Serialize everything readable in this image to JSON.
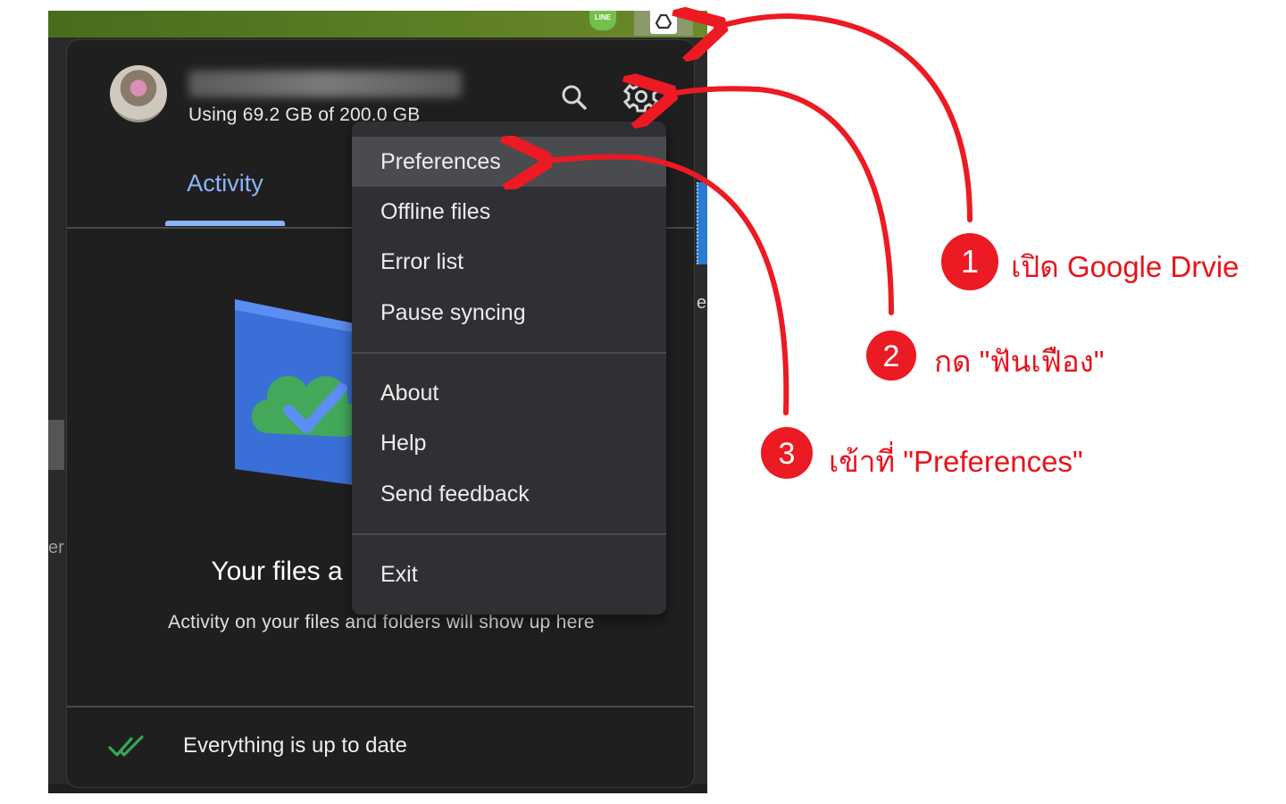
{
  "tray": {
    "line_icon_text": "LINE"
  },
  "background": {
    "fragment_right": "e",
    "fragment_left": "er"
  },
  "account": {
    "storage_text": "Using 69.2 GB of 200.0 GB"
  },
  "tabs": [
    {
      "label": "Activity",
      "active": true
    }
  ],
  "empty_state": {
    "title": "Your files a",
    "subtitle": "Activity on your files and folders will show up here"
  },
  "footer": {
    "status_text": "Everything is up to date"
  },
  "settings_menu": {
    "items": [
      {
        "label": "Preferences"
      },
      {
        "label": "Offline files"
      },
      {
        "label": "Error list"
      },
      {
        "label": "Pause syncing"
      },
      {
        "label": "About"
      },
      {
        "label": "Help"
      },
      {
        "label": "Send feedback"
      },
      {
        "label": "Exit"
      }
    ]
  },
  "annotations": [
    {
      "number": "1",
      "text": "เปิด Google Drvie"
    },
    {
      "number": "2",
      "text": "กด \"ฟันเฟือง\""
    },
    {
      "number": "3",
      "text": "เข้าที่ \"Preferences\""
    }
  ],
  "colors": {
    "annotation_red": "#ec1a22",
    "accent_blue": "#8ab4f8",
    "panel_bg": "#1f1f1f",
    "menu_bg": "#2f3033",
    "sync_green": "#34a853"
  },
  "icons": {
    "search": "search-icon",
    "settings": "gear-icon",
    "drive": "google-drive-icon",
    "sync_status": "double-check-icon",
    "illustration": "cloud-check-folder-icon"
  }
}
